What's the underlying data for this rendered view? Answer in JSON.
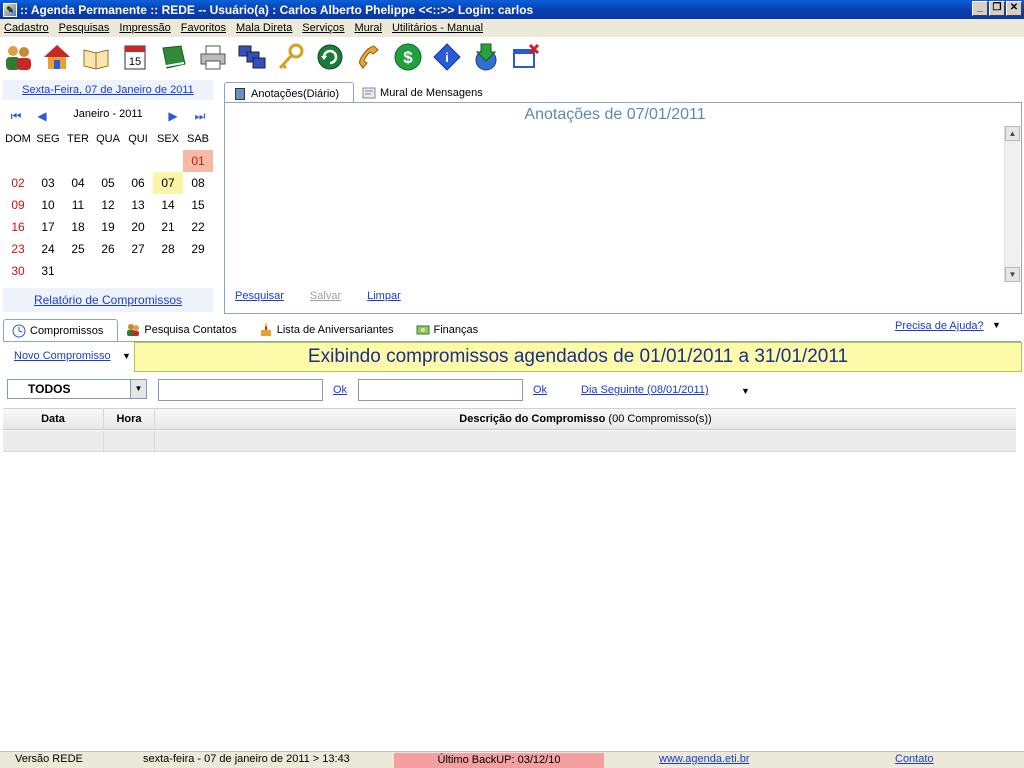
{
  "window": {
    "title": ":: Agenda Permanente :: REDE -- Usuário(a) : Carlos Alberto Phelippe <<::>> Login: carlos"
  },
  "menu": [
    "Cadastro",
    "Pesquisas",
    "Impressão",
    "Favoritos",
    "Mala Direta",
    "Serviços",
    "Mural",
    "Utilitários - Manual"
  ],
  "toolbar": [
    "users-icon",
    "home-icon",
    "book-icon",
    "calendar-icon",
    "green-book-icon",
    "printer-icon",
    "computers-icon",
    "key-icon",
    "refresh-icon",
    "phone-icon",
    "dollar-icon",
    "info-icon",
    "download-globe-icon",
    "close-window-icon"
  ],
  "calendar": {
    "current_date": "Sexta-Feira, 07 de Janeiro de 2011",
    "month_label": "Janeiro - 2011",
    "weekdays": [
      "DOM",
      "SEG",
      "TER",
      "QUA",
      "QUI",
      "SEX",
      "SAB"
    ],
    "weeks": [
      [
        "",
        "",
        "",
        "",
        "",
        "",
        "01"
      ],
      [
        "02",
        "03",
        "04",
        "05",
        "06",
        "07",
        "08"
      ],
      [
        "09",
        "10",
        "11",
        "12",
        "13",
        "14",
        "15"
      ],
      [
        "16",
        "17",
        "18",
        "19",
        "20",
        "21",
        "22"
      ],
      [
        "23",
        "24",
        "25",
        "26",
        "27",
        "28",
        "29"
      ],
      [
        "30",
        "31",
        "",
        "",
        "",
        "",
        ""
      ]
    ],
    "report_link": "Relatório de Compromissos"
  },
  "notes": {
    "tabs": [
      "Anotações(Diário)",
      "Mural de Mensagens"
    ],
    "title": "Anotações de 07/01/2011",
    "actions": [
      "Pesquisar",
      "Salvar",
      "Limpar"
    ]
  },
  "bottom_tabs": [
    "Compromissos",
    "Pesquisa Contatos",
    "Lista de Aniversariantes",
    "Finanças"
  ],
  "help_link": "Precisa de Ajuda?",
  "appointments": {
    "new_link": "Novo Compromisso",
    "banner": "Exibindo compromissos agendados de 01/01/2011 a 31/01/2011",
    "filter_value": "TODOS",
    "ok1": "Ok",
    "ok2": "Ok",
    "next_day": "Dia Seguinte (08/01/2011)",
    "columns": {
      "data": "Data",
      "hora": "Hora",
      "descricao": "Descrição do Compromisso",
      "count": "(00 Compromisso(s))"
    }
  },
  "status": {
    "version": "Versão REDE",
    "datetime": "sexta-feira - 07 de janeiro de 2011  >  13:43",
    "backup": "Último BackUP: 03/12/10",
    "website": "www.agenda.eti.br",
    "contact": "Contato"
  },
  "colors": {
    "title_bar": "#0b3fb3",
    "link": "#1a3ccd",
    "banner_bg": "#fdfbaa",
    "today_highlight": "#fbf5a8",
    "selected_day": "#f6b9a4",
    "backup_bg": "#f4a0a0"
  }
}
